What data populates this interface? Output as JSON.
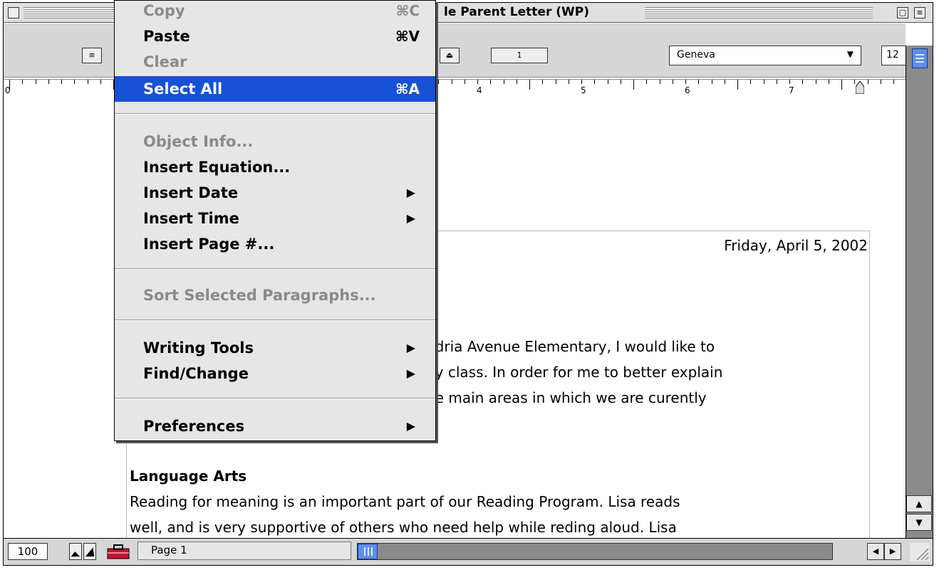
{
  "window": {
    "title": "le Parent Letter (WP)",
    "zoom_icon": "zoom-box-icon",
    "collapse_icon": "collapse-box-icon"
  },
  "toolbar": {
    "page_display_label": "1",
    "font_name": "Geneva",
    "font_size": "12"
  },
  "ruler": {
    "labels": [
      "0",
      "4",
      "5",
      "6",
      "7"
    ]
  },
  "menu": {
    "items": [
      {
        "label": "Copy",
        "shortcut": "⌘C",
        "enabled": false
      },
      {
        "label": "Paste",
        "shortcut": "⌘V",
        "enabled": true
      },
      {
        "label": "Clear",
        "shortcut": "",
        "enabled": false
      },
      {
        "label": "Select All",
        "shortcut": "⌘A",
        "enabled": true,
        "highlighted": true
      },
      {
        "label": "Object Info...",
        "shortcut": "",
        "enabled": false
      },
      {
        "label": "Insert Equation...",
        "shortcut": "",
        "enabled": true
      },
      {
        "label": "Insert Date",
        "submenu": true,
        "enabled": true
      },
      {
        "label": "Insert Time",
        "submenu": true,
        "enabled": true
      },
      {
        "label": "Insert Page #...",
        "shortcut": "",
        "enabled": true
      },
      {
        "label": "Sort Selected Paragraphs...",
        "shortcut": "",
        "enabled": false
      },
      {
        "label": "Writing Tools",
        "submenu": true,
        "enabled": true
      },
      {
        "label": "Find/Change",
        "submenu": true,
        "enabled": true
      },
      {
        "label": "Preferences",
        "submenu": true,
        "enabled": true
      }
    ]
  },
  "document": {
    "date": "Friday, April 5, 2002",
    "para1_line1": "ndria Avenue Elementary, I would like to",
    "para1_line2": "ny class. In order for me to better explain",
    "para1_line3": "he main areas in which we are curently",
    "heading": "Language Arts",
    "para2_line1": "Reading for meaning is an important part of our Reading Program. Lisa reads",
    "para2_line2": "well, and is very supportive of others who need help while reding aloud. Lisa"
  },
  "status": {
    "zoom": "100",
    "page": "Page 1"
  },
  "colors": {
    "highlight": "#1651d6",
    "scroll_thumb": "#5b8df0"
  }
}
